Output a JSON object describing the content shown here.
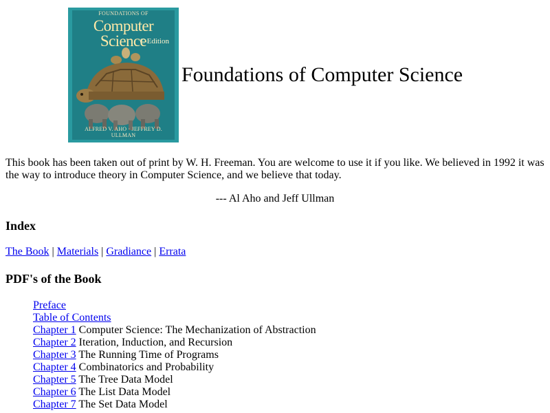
{
  "header": {
    "title": "Foundations of Computer Science",
    "cover": {
      "top_text": "FOUNDATIONS OF",
      "big_text": "Computer Science",
      "edition": "C Edition",
      "authors": "ALFRED V. AHO · JEFFREY D. ULLMAN",
      "colors": {
        "border": "#2a9aa0",
        "panel": "#1f7f86",
        "turtle": "#8a6a3a"
      }
    }
  },
  "intro": {
    "text": "This book has been taken out of print by W. H. Freeman. You are welcome to use it if you like. We believed in 1992 it was the way to introduce theory in Computer Science, and we believe that today.",
    "signature": "--- Al Aho and Jeff Ullman"
  },
  "index": {
    "heading": "Index",
    "links": [
      "The Book",
      "Materials",
      "Gradiance",
      "Errata"
    ],
    "separator": "|"
  },
  "pdfs": {
    "heading": "PDF's of the Book",
    "items": [
      {
        "link": "Preface",
        "title": ""
      },
      {
        "link": "Table of Contents",
        "title": ""
      },
      {
        "link": "Chapter 1",
        "title": "Computer Science: The Mechanization of Abstraction"
      },
      {
        "link": "Chapter 2",
        "title": "Iteration, Induction, and Recursion"
      },
      {
        "link": "Chapter 3",
        "title": "The Running Time of Programs"
      },
      {
        "link": "Chapter 4",
        "title": "Combinatorics and Probability"
      },
      {
        "link": "Chapter 5",
        "title": "The Tree Data Model"
      },
      {
        "link": "Chapter 6",
        "title": "The List Data Model"
      },
      {
        "link": "Chapter 7",
        "title": "The Set Data Model"
      }
    ]
  },
  "link_color": "#0000ee"
}
